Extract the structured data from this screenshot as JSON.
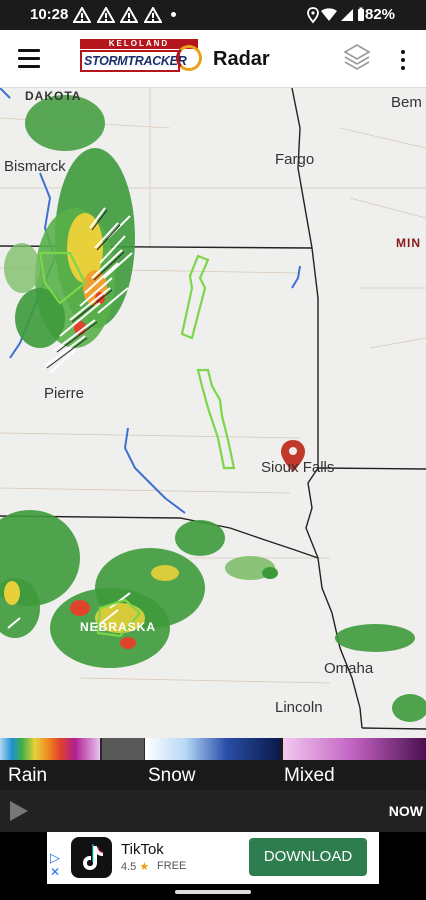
{
  "status_bar": {
    "time": "10:28",
    "battery": "82%",
    "icons": [
      "warning-icon",
      "warning-icon",
      "warning-icon",
      "dot-icon",
      "location-icon",
      "wifi-icon",
      "signal-icon",
      "battery-icon"
    ]
  },
  "app_bar": {
    "logo_top": "KELOLAND",
    "logo_main": "STORMTRACKER",
    "title": "Radar",
    "icons": [
      "menu-icon",
      "layers-icon",
      "more-vert-icon"
    ]
  },
  "map": {
    "state_labels": {
      "dakota": "DAKOTA",
      "nebraska": "NEBRASKA",
      "minnesota": "MIN"
    },
    "cities": {
      "bismarck": "Bismarck",
      "fargo": "Fargo",
      "bemidji": "Bem",
      "pierre": "Pierre",
      "sioux_falls": "Sioux Falls",
      "omaha": "Omaha",
      "lincoln": "Lincoln"
    },
    "colors": {
      "background": "#efefed",
      "rain_light": "#7fbf6a",
      "rain_medium": "#3d9a3a",
      "rain_heavy": "#e8d03a",
      "rain_severe": "#e0432b",
      "warning_box": "#7cd64a",
      "river": "#3f6fd1",
      "border": "#222222"
    }
  },
  "legend": {
    "rain": "Rain",
    "snow": "Snow",
    "mixed": "Mixed"
  },
  "playback": {
    "now": "NOW"
  },
  "ad": {
    "app_name": "TikTok",
    "rating": "4.5",
    "price": "FREE",
    "cta": "DOWNLOAD"
  }
}
